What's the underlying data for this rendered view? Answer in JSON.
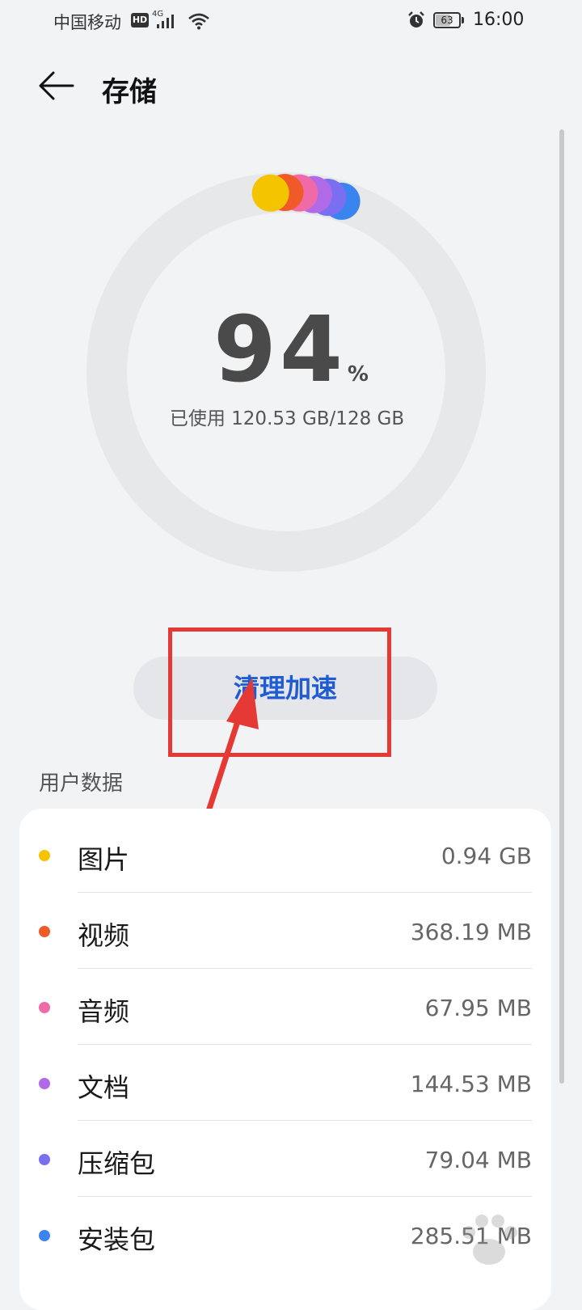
{
  "status_bar": {
    "carrier": "中国移动",
    "hd": "HD",
    "network": "4G",
    "battery": "63",
    "battery_level": 0.63,
    "time": "16:00"
  },
  "header": {
    "title": "存储"
  },
  "storage": {
    "percent": "94",
    "percent_sign": "%",
    "used_text": "已使用 120.53 GB/128 GB",
    "used_fraction": 0.94
  },
  "actions": {
    "clean_label": "清理加速"
  },
  "user_data": {
    "section_title": "用户数据",
    "items": [
      {
        "label": "图片",
        "value": "0.94 GB",
        "color": "#f5c400"
      },
      {
        "label": "视频",
        "value": "368.19 MB",
        "color": "#f05a28"
      },
      {
        "label": "音频",
        "value": "67.95 MB",
        "color": "#f06aa8"
      },
      {
        "label": "文档",
        "value": "144.53 MB",
        "color": "#b06ae8"
      },
      {
        "label": "压缩包",
        "value": "79.04 MB",
        "color": "#7a6ff0"
      },
      {
        "label": "安装包",
        "value": "285.51 MB",
        "color": "#3a84f0"
      }
    ]
  },
  "annotation": {
    "color": "#e53935"
  }
}
